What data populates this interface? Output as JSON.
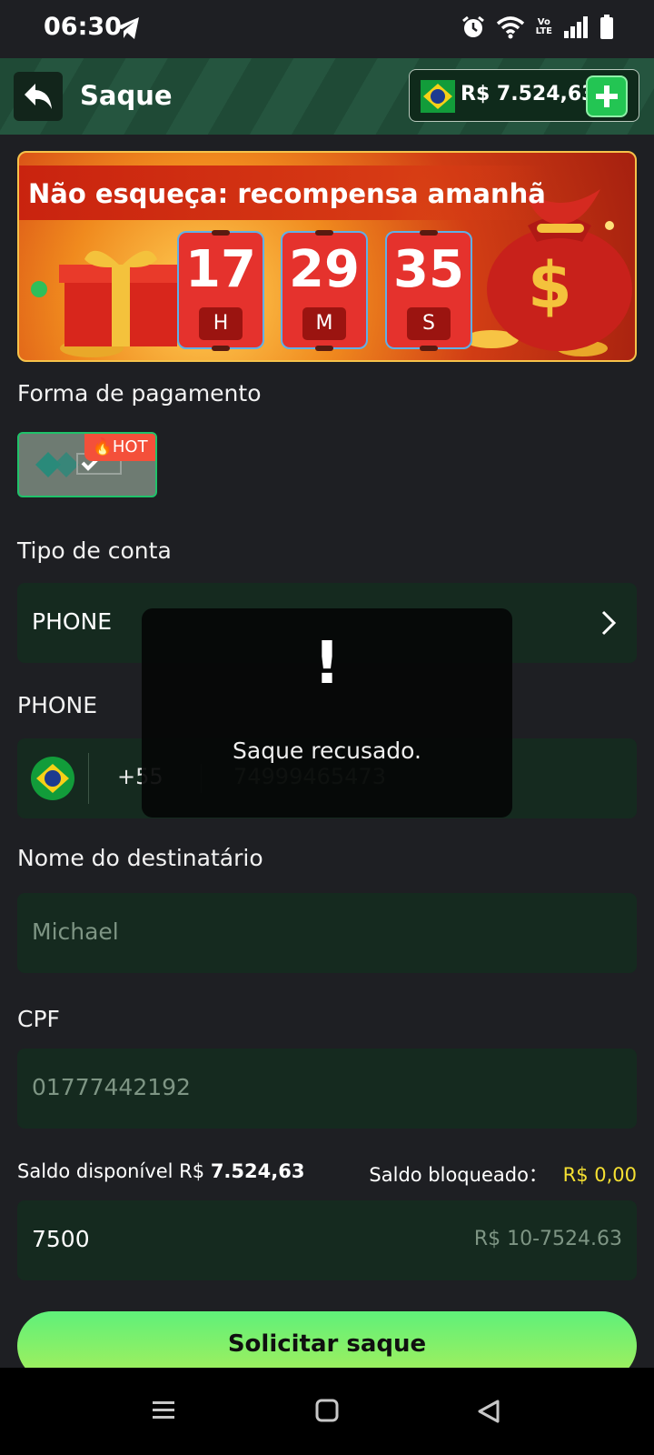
{
  "status_bar": {
    "time": "06:30",
    "volte_top": "Vo",
    "volte_bottom": "LTE"
  },
  "header": {
    "title": "Saque",
    "balance": "R$ 7.524,63"
  },
  "banner": {
    "title": "Não esqueça: recompensa amanhã",
    "countdown": [
      {
        "value": "17",
        "unit": "H"
      },
      {
        "value": "29",
        "unit": "M"
      },
      {
        "value": "35",
        "unit": "S"
      }
    ]
  },
  "payment": {
    "label": "Forma de pagamento",
    "method_logo": "pix",
    "badge": "HOT"
  },
  "account_type": {
    "label": "Tipo de conta",
    "value": "PHONE"
  },
  "phone": {
    "label": "PHONE",
    "country_code": "+55",
    "placeholder": "74999465473"
  },
  "recipient": {
    "label": "Nome do destinatário",
    "value": "Michael"
  },
  "cpf": {
    "label": "CPF",
    "value": "01777442192"
  },
  "saldo": {
    "available_label": "Saldo disponível R$ ",
    "available_value": "7.524,63",
    "blocked_label": "Saldo bloqueado：",
    "blocked_value": "R$ 0,00"
  },
  "amount": {
    "value": "7500",
    "range": "R$ 10-7524.63"
  },
  "submit_label": "Solicitar saque",
  "toast": {
    "icon": "!",
    "message": "Saque recusado."
  },
  "icons": [
    "telegram-icon",
    "alarm-icon",
    "wifi-icon",
    "signal-icon",
    "battery-icon",
    "back-arrow-icon",
    "brazil-flag-icon",
    "plus-icon",
    "chevron-right-icon",
    "menu-icon",
    "home-icon",
    "back-icon"
  ],
  "colors": {
    "accent_green": "#23c553",
    "field_bg": "#152a1f",
    "blocked_yellow": "#f5e032",
    "background": "#1e1f23"
  }
}
